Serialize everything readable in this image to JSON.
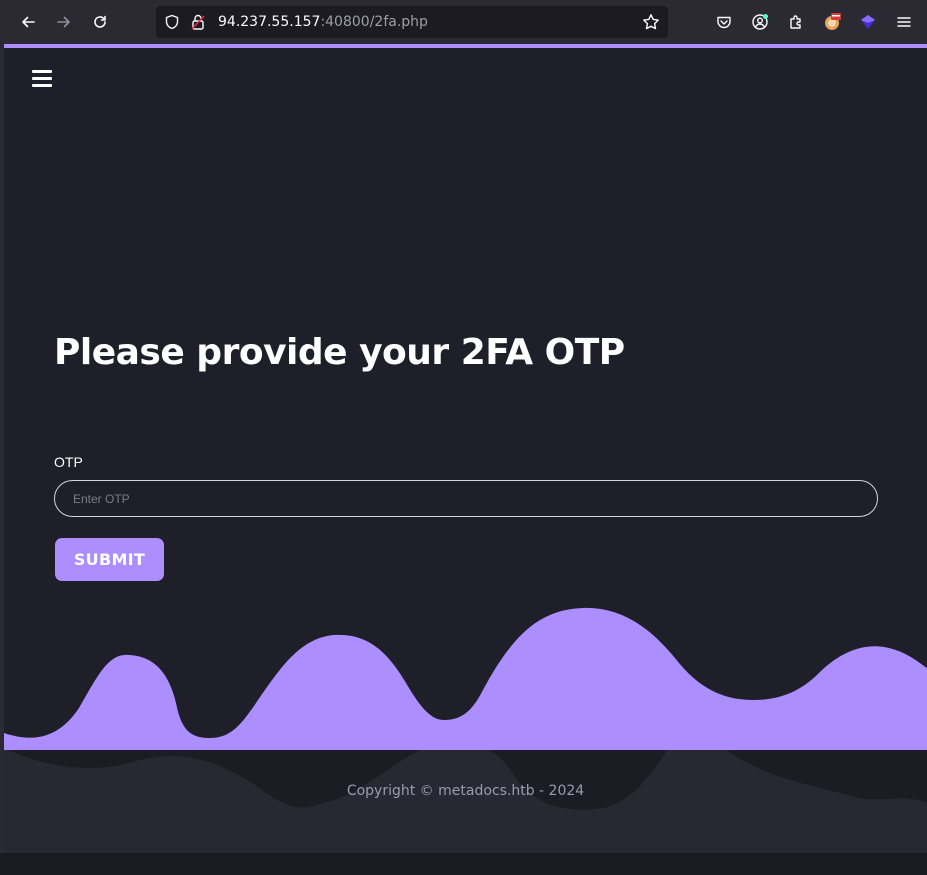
{
  "browser": {
    "url_host": "94.237.55.157",
    "url_rest": ":40800/2fa.php",
    "icons": {
      "back": "back-arrow-icon",
      "forward": "forward-arrow-icon",
      "reload": "reload-icon",
      "shield": "shield-icon",
      "lock": "insecure-lock-icon",
      "bookmark": "star-icon",
      "pocket": "pocket-icon",
      "account": "account-icon",
      "extensions": "puzzle-icon",
      "extension_1": "extension-icon",
      "extension_2": "extension-icon",
      "menu": "hamburger-icon"
    }
  },
  "page": {
    "menu_icon": "hamburger-icon",
    "heading": "Please provide your 2FA OTP",
    "form": {
      "otp_label": "OTP",
      "otp_placeholder": "Enter OTP",
      "otp_value": "",
      "submit_label": "SUBMIT"
    },
    "footer": {
      "copyright": "Copyright © metadocs.htb - 2024"
    }
  },
  "colors": {
    "accent": "#ac8eff",
    "page_bg": "#1f1f29",
    "footer_bg": "#282832",
    "chrome_bg": "#2b2a33"
  }
}
